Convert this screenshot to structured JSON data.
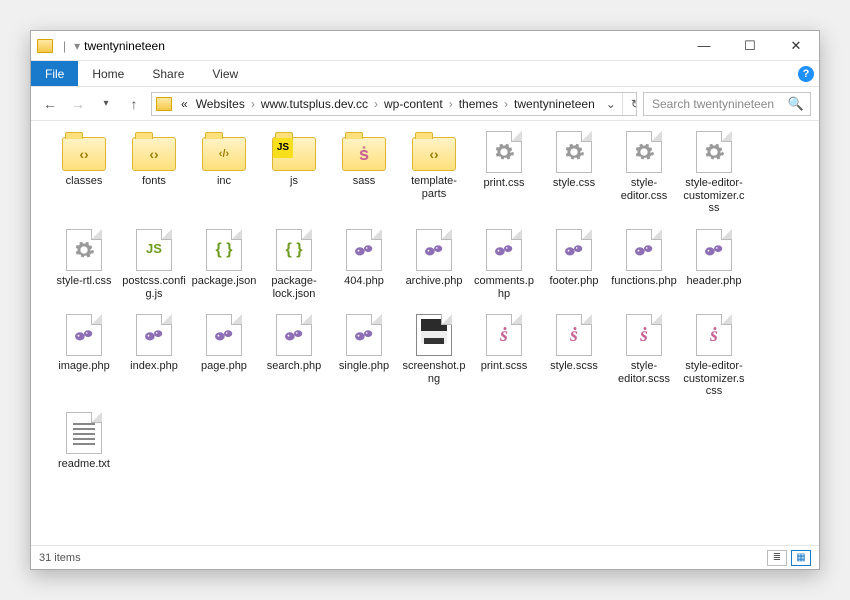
{
  "titlebar": {
    "title": "twentynineteen"
  },
  "ribbon": {
    "file": "File",
    "home": "Home",
    "share": "Share",
    "view": "View"
  },
  "breadcrumbs": {
    "prefix": "«",
    "seg1": "Websites",
    "seg2": "www.tutsplus.dev.cc",
    "seg3": "wp-content",
    "seg4": "themes",
    "seg5": "twentynineteen"
  },
  "search": {
    "placeholder": "Search twentynineteen"
  },
  "status": {
    "count": "31 items"
  },
  "items": [
    {
      "name": "classes",
      "kind": "folder",
      "badge": "code"
    },
    {
      "name": "fonts",
      "kind": "folder",
      "badge": "code"
    },
    {
      "name": "inc",
      "kind": "folder",
      "badge": "inc"
    },
    {
      "name": "js",
      "kind": "folder",
      "badge": "js"
    },
    {
      "name": "sass",
      "kind": "folder",
      "badge": "sass"
    },
    {
      "name": "template-parts",
      "kind": "folder",
      "badge": "code"
    },
    {
      "name": "print.css",
      "kind": "gear"
    },
    {
      "name": "style.css",
      "kind": "gear"
    },
    {
      "name": "style-editor.css",
      "kind": "gear"
    },
    {
      "name": "style-editor-customizer.css",
      "kind": "gear"
    },
    {
      "name": "style-rtl.css",
      "kind": "gear"
    },
    {
      "name": "postcss.config.js",
      "kind": "js"
    },
    {
      "name": "package.json",
      "kind": "braces"
    },
    {
      "name": "package-lock.json",
      "kind": "braces"
    },
    {
      "name": "404.php",
      "kind": "php"
    },
    {
      "name": "archive.php",
      "kind": "php"
    },
    {
      "name": "comments.php",
      "kind": "php"
    },
    {
      "name": "footer.php",
      "kind": "php"
    },
    {
      "name": "functions.php",
      "kind": "php"
    },
    {
      "name": "header.php",
      "kind": "php"
    },
    {
      "name": "image.php",
      "kind": "php"
    },
    {
      "name": "index.php",
      "kind": "php"
    },
    {
      "name": "page.php",
      "kind": "php"
    },
    {
      "name": "search.php",
      "kind": "php"
    },
    {
      "name": "single.php",
      "kind": "php"
    },
    {
      "name": "screenshot.png",
      "kind": "png"
    },
    {
      "name": "print.scss",
      "kind": "sassf"
    },
    {
      "name": "style.scss",
      "kind": "sassf"
    },
    {
      "name": "style-editor.scss",
      "kind": "sassf"
    },
    {
      "name": "style-editor-customizer.scss",
      "kind": "sassf"
    },
    {
      "name": "readme.txt",
      "kind": "txt"
    }
  ]
}
